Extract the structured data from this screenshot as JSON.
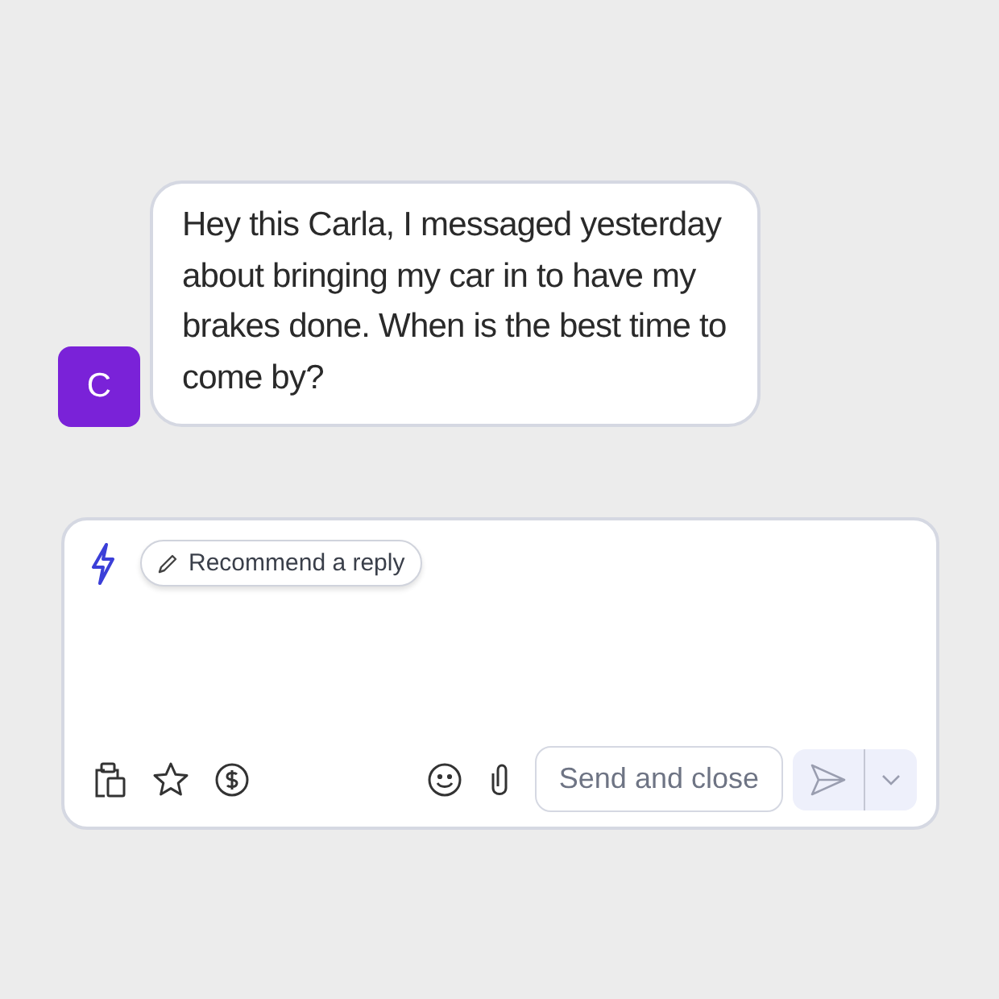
{
  "message": {
    "avatar": "C",
    "text": "Hey this Carla, I messaged yesterday about bringing my car in to have my brakes done. When is the best time to come by?"
  },
  "composer": {
    "recommend_button": "Recommend a reply",
    "send_close_button": "Send and close",
    "send_disabled": true
  }
}
